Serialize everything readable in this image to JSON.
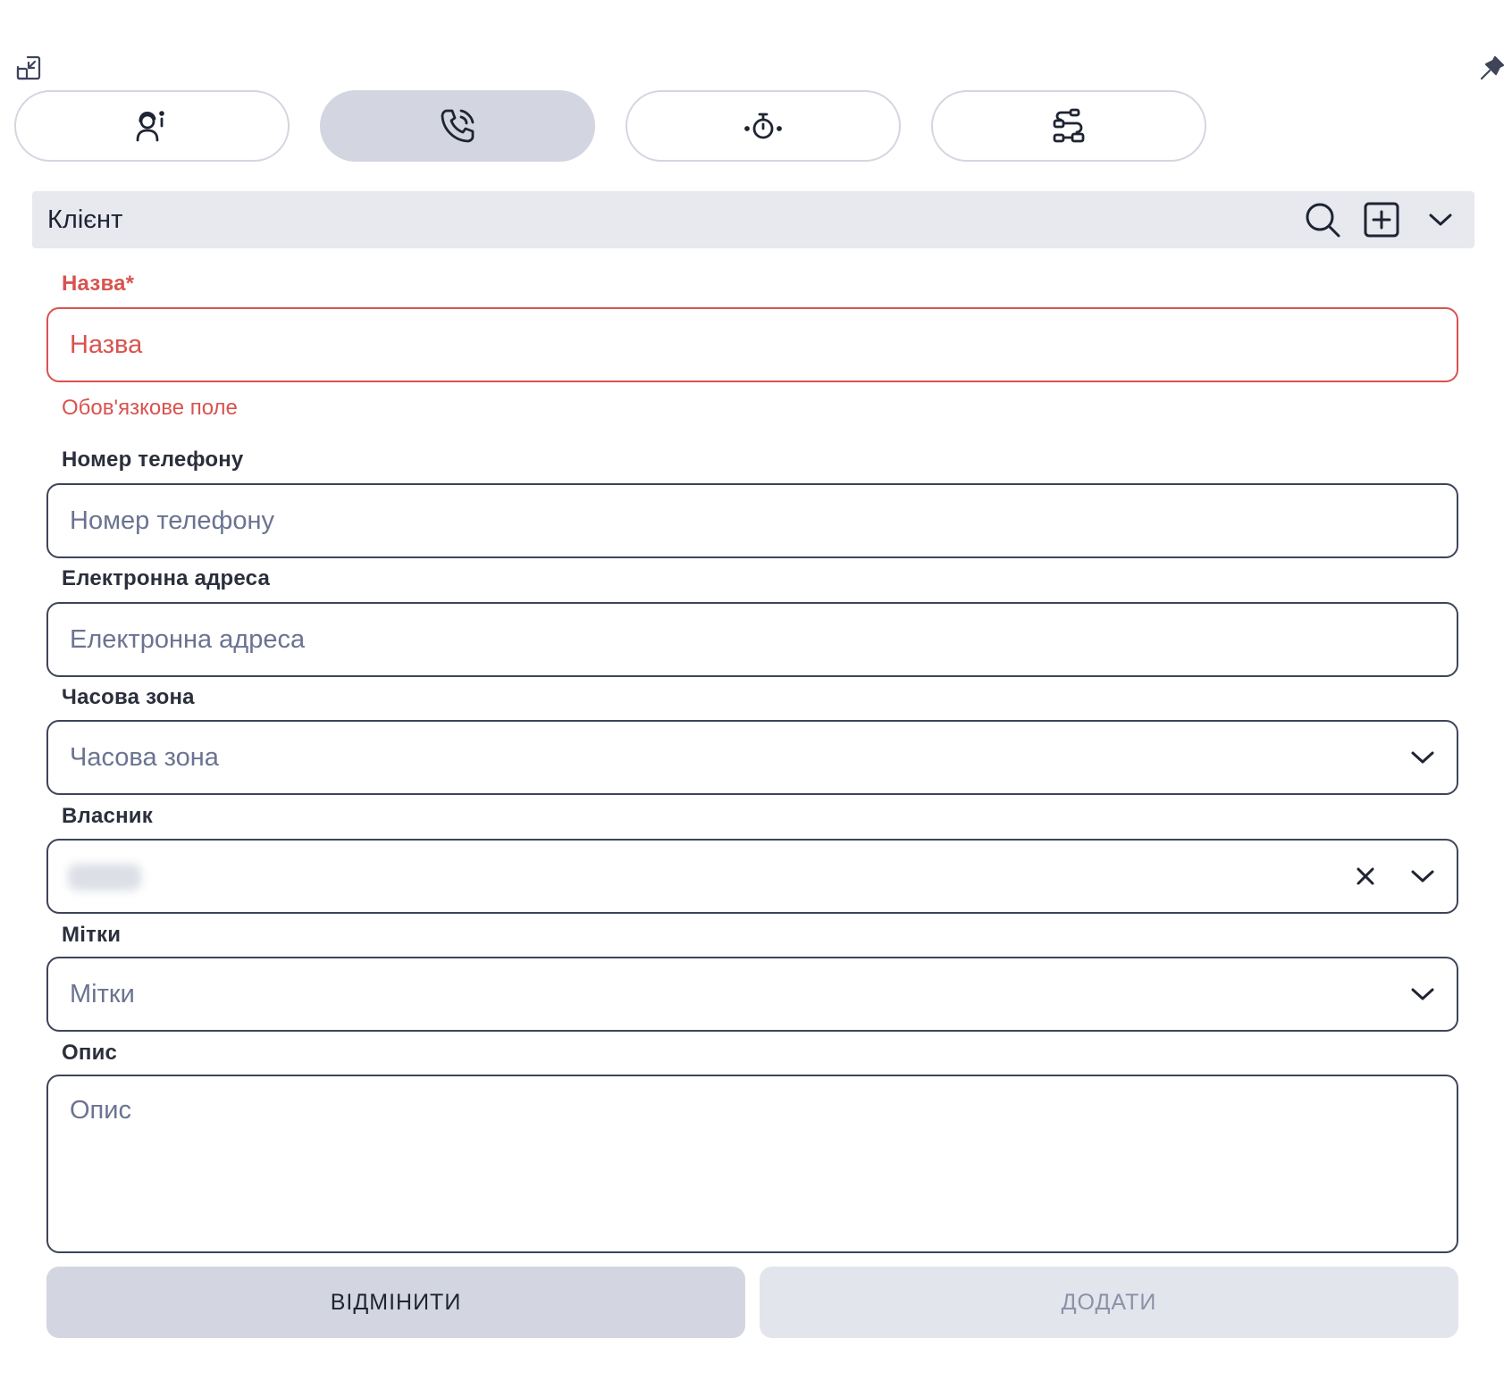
{
  "toolbar": {
    "collapse_icon": "collapse-window-icon",
    "pin_icon": "pin-icon"
  },
  "tabs": [
    {
      "icon": "contact-info-icon",
      "active": false
    },
    {
      "icon": "phone-icon",
      "active": true
    },
    {
      "icon": "stopwatch-icon",
      "active": false
    },
    {
      "icon": "flow-icon",
      "active": false
    }
  ],
  "section": {
    "title": "Клієнт",
    "search_icon": "search-icon",
    "add_icon": "plus-square-icon",
    "collapse_icon": "chevron-down-icon"
  },
  "form": {
    "name": {
      "label": "Назва*",
      "placeholder": "Назва",
      "value": "",
      "error": "Обов'язкове поле"
    },
    "phone": {
      "label": "Номер телефону",
      "placeholder": "Номер телефону",
      "value": ""
    },
    "email": {
      "label": "Електронна адреса",
      "placeholder": "Електронна адреса",
      "value": ""
    },
    "timezone": {
      "label": "Часова зона",
      "placeholder": "Часова зона"
    },
    "owner": {
      "label": "Власник"
    },
    "tags": {
      "label": "Мітки",
      "placeholder": "Мітки"
    },
    "description": {
      "label": "Опис",
      "placeholder": "Опис",
      "value": ""
    }
  },
  "actions": {
    "cancel_label": "ВІДМІНИТИ",
    "add_label": "ДОДАТИ"
  },
  "colors": {
    "error": "#d9534f",
    "border": "#3e4459",
    "tab_active": "#d3d6e0",
    "section_bg": "#e8e9ef"
  }
}
